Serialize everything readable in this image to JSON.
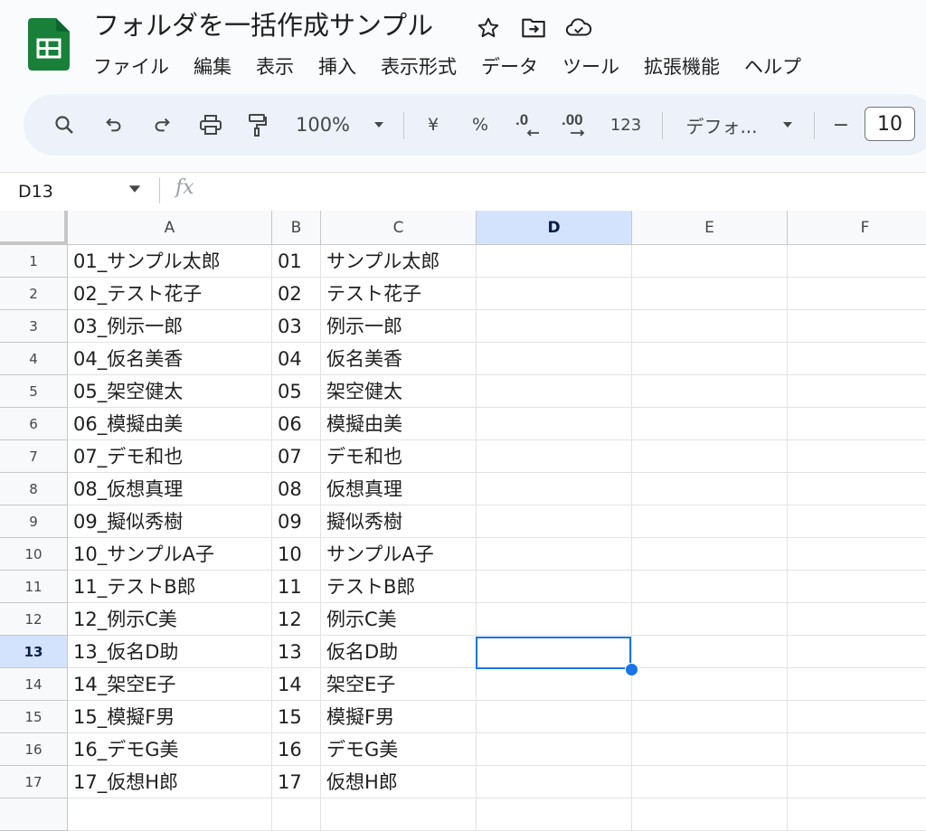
{
  "doc": {
    "title": "フォルダを一括作成サンプル",
    "menu": [
      "ファイル",
      "編集",
      "表示",
      "挿入",
      "表示形式",
      "データ",
      "ツール",
      "拡張機能",
      "ヘルプ"
    ]
  },
  "toolbar": {
    "zoom": "100%",
    "currency": "¥",
    "percent": "%",
    "dec_decrease": ".0",
    "dec_increase": ".00",
    "number_format": "123",
    "font": "デフォ...",
    "minus": "−",
    "font_size": "10"
  },
  "formula_bar": {
    "name_box": "D13",
    "fx": "fx"
  },
  "grid": {
    "columns": [
      "A",
      "B",
      "C",
      "D",
      "E",
      "F"
    ],
    "selected_column": "D",
    "selected_row": "13",
    "rows": [
      {
        "num": "1",
        "a": "01_サンプル太郎",
        "b": "01",
        "c": "サンプル太郎"
      },
      {
        "num": "2",
        "a": "02_テスト花子",
        "b": "02",
        "c": "テスト花子"
      },
      {
        "num": "3",
        "a": "03_例示一郎",
        "b": "03",
        "c": "例示一郎"
      },
      {
        "num": "4",
        "a": "04_仮名美香",
        "b": "04",
        "c": "仮名美香"
      },
      {
        "num": "5",
        "a": "05_架空健太",
        "b": "05",
        "c": "架空健太"
      },
      {
        "num": "6",
        "a": "06_模擬由美",
        "b": "06",
        "c": "模擬由美"
      },
      {
        "num": "7",
        "a": "07_デモ和也",
        "b": "07",
        "c": "デモ和也"
      },
      {
        "num": "8",
        "a": "08_仮想真理",
        "b": "08",
        "c": "仮想真理"
      },
      {
        "num": "9",
        "a": "09_擬似秀樹",
        "b": "09",
        "c": "擬似秀樹"
      },
      {
        "num": "10",
        "a": "10_サンプルA子",
        "b": "10",
        "c": "サンプルA子"
      },
      {
        "num": "11",
        "a": "11_テストB郎",
        "b": "11",
        "c": "テストB郎"
      },
      {
        "num": "12",
        "a": "12_例示C美",
        "b": "12",
        "c": "例示C美"
      },
      {
        "num": "13",
        "a": "13_仮名D助",
        "b": "13",
        "c": "仮名D助"
      },
      {
        "num": "14",
        "a": "14_架空E子",
        "b": "14",
        "c": "架空E子"
      },
      {
        "num": "15",
        "a": "15_模擬F男",
        "b": "15",
        "c": "模擬F男"
      },
      {
        "num": "16",
        "a": "16_デモG美",
        "b": "16",
        "c": "デモG美"
      },
      {
        "num": "17",
        "a": "17_仮想H郎",
        "b": "17",
        "c": "仮想H郎"
      }
    ]
  },
  "colors": {
    "accent": "#1a73e8",
    "sheets_green": "#188038",
    "selected_header": "#d3e3fd"
  }
}
